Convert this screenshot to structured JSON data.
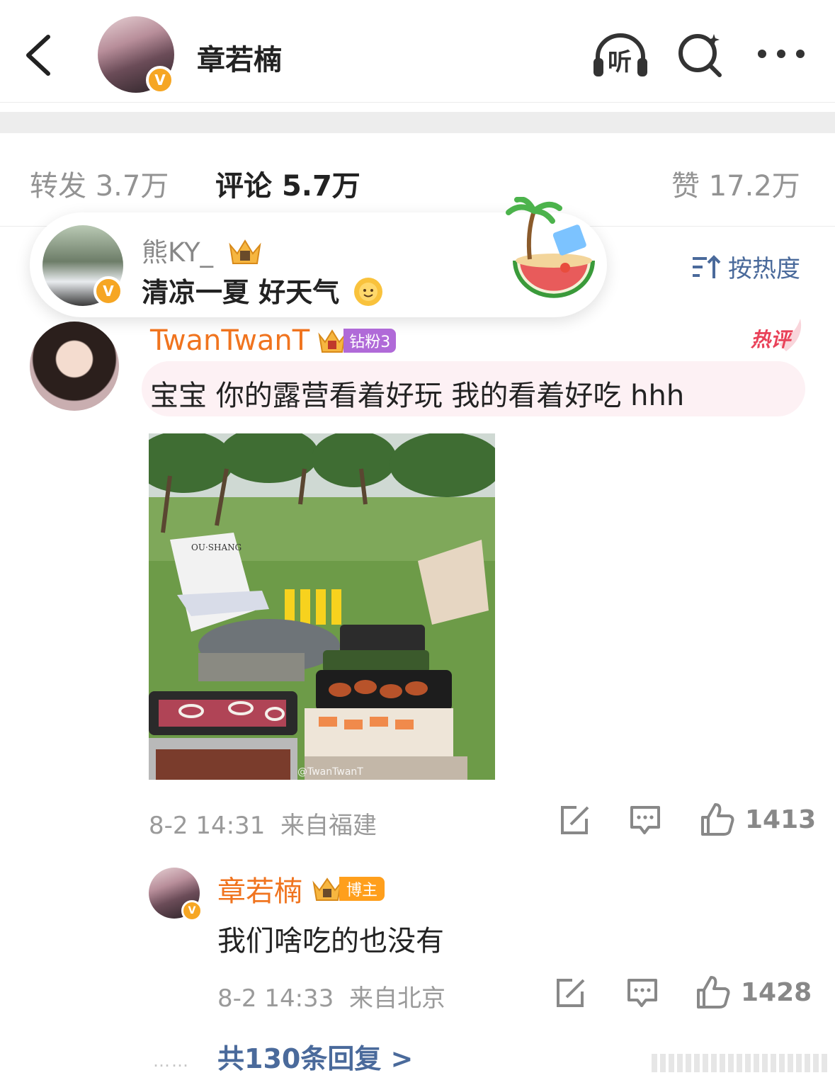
{
  "header": {
    "author_name": "章若楠",
    "listen_label": "听"
  },
  "stats": {
    "repost_label": "转发",
    "repost_count": "3.7万",
    "comment_label": "评论",
    "comment_count": "5.7万",
    "like_label": "赞",
    "like_count": "17.2万"
  },
  "floating_card": {
    "name": "熊KY_",
    "text": "清凉一夏  好天气"
  },
  "sort": {
    "label": "按热度"
  },
  "comment": {
    "user": "TwanTwanT",
    "fan_badge": "钻粉3",
    "hot_label": "热评",
    "text": "宝宝 你的露营看着好玩 我的看着好吃 hhh",
    "photo_sign": "OU·SHANG",
    "watermark": "@TwanTwanT",
    "time": "8-2 14:31",
    "location": "来自福建",
    "likes": "1413"
  },
  "reply": {
    "user": "章若楠",
    "badge": "博主",
    "text": "我们啥吃的也没有",
    "time": "8-2 14:33",
    "location": "来自北京",
    "likes": "1428"
  },
  "more_replies": {
    "dots": "……",
    "label": "共130条回复 >"
  },
  "colors": {
    "orange_name": "#f0741f",
    "link_blue": "#4a6a9b",
    "verified_gold": "#f6a623"
  }
}
